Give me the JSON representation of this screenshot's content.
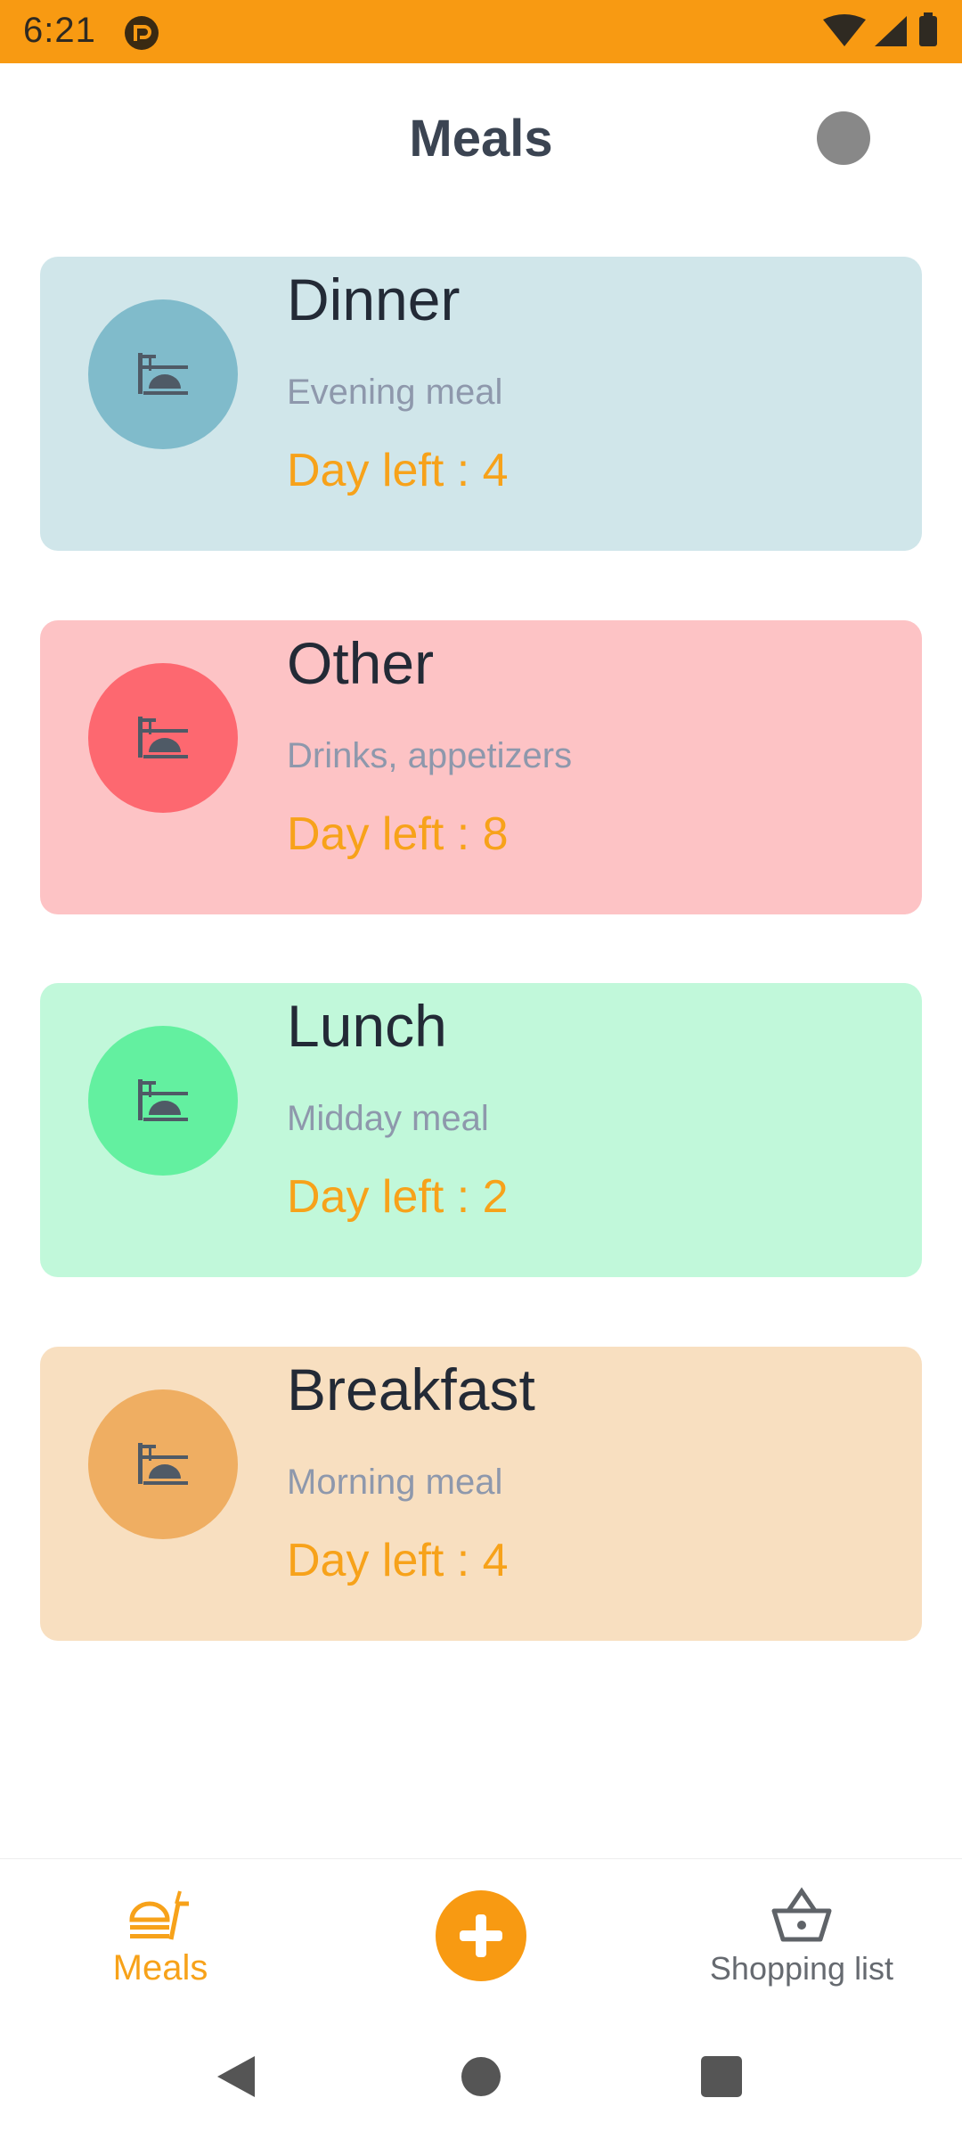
{
  "status_bar": {
    "time": "6:21",
    "color": "#F89A12"
  },
  "header": {
    "title": "Meals"
  },
  "meals": [
    {
      "name": "Dinner",
      "description": "Evening meal",
      "days_left": "Day left : 4",
      "card_color": "#D0E6EA",
      "circle_color": "#80BBCB",
      "icon": "noodle-bowl-icon"
    },
    {
      "name": "Other",
      "description": "Drinks, appetizers",
      "days_left": "Day left : 8",
      "card_color": "#FDC3C5",
      "circle_color": "#FD6870",
      "icon": "noodle-bowl-icon"
    },
    {
      "name": "Lunch",
      "description": "Midday meal",
      "days_left": "Day left : 2",
      "card_color": "#C1F8DA",
      "circle_color": "#63F0A0",
      "icon": "noodle-bowl-icon"
    },
    {
      "name": "Breakfast",
      "description": "Morning meal",
      "days_left": "Day left : 4",
      "card_color": "#F8DFC0",
      "circle_color": "#EFAE62",
      "icon": "noodle-bowl-icon"
    }
  ],
  "bottom_nav": {
    "meals_label": "Meals",
    "shopping_label": "Shopping list",
    "accent": "#F7A21A"
  }
}
